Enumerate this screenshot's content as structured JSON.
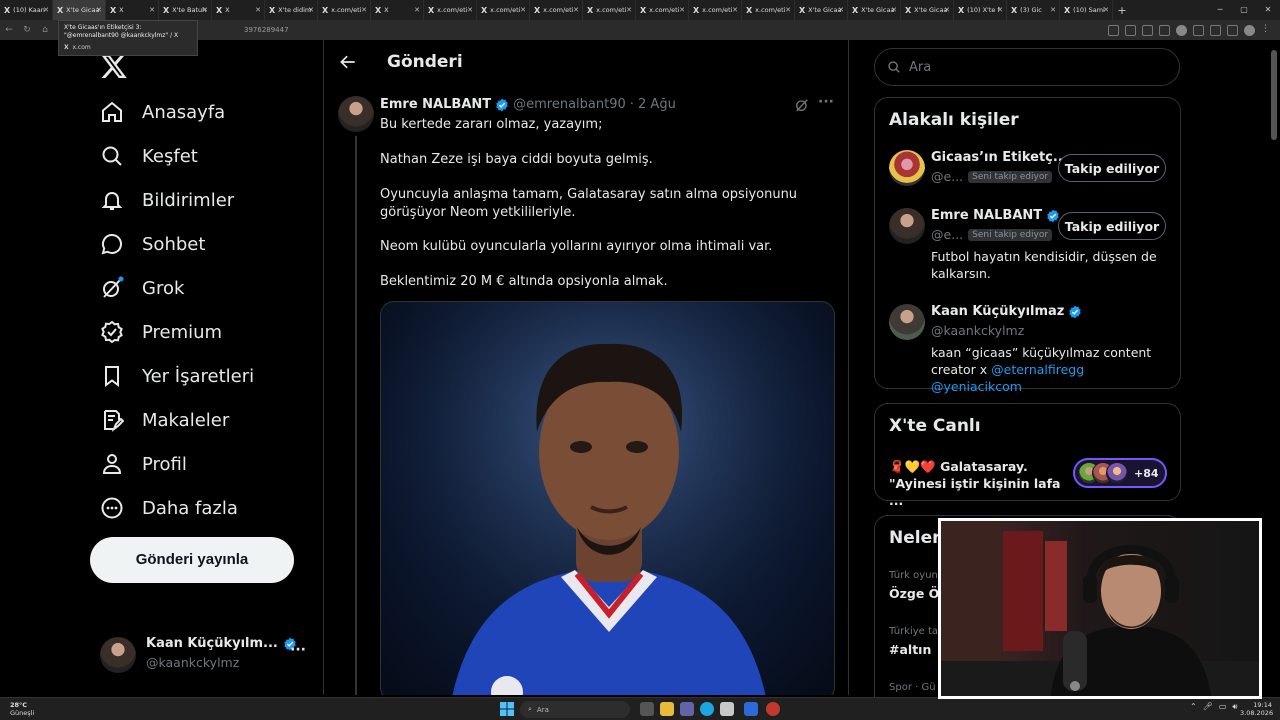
{
  "browser": {
    "tabs": [
      {
        "label": "(10) Kaan",
        "active": false
      },
      {
        "label": "X'te Gicaa",
        "active": true
      },
      {
        "label": "X",
        "active": false
      },
      {
        "label": "X'te Batuh",
        "active": false
      },
      {
        "label": "X",
        "active": false
      },
      {
        "label": "X'te didim",
        "active": false
      },
      {
        "label": "x.com/eti",
        "active": false
      },
      {
        "label": "X",
        "active": false
      },
      {
        "label": "x.com/eti",
        "active": false
      },
      {
        "label": "x.com/eti",
        "active": false
      },
      {
        "label": "x.com/eti",
        "active": false
      },
      {
        "label": "x.com/eti",
        "active": false
      },
      {
        "label": "x.com/eti",
        "active": false
      },
      {
        "label": "x.com/eti",
        "active": false
      },
      {
        "label": "x.com/eti",
        "active": false
      },
      {
        "label": "X'te Gicaa",
        "active": false
      },
      {
        "label": "X'te Gicaa",
        "active": false
      },
      {
        "label": "X'te Gicaa",
        "active": false
      },
      {
        "label": "(10) X'te f",
        "active": false
      },
      {
        "label": "(3) Gic",
        "active": false
      },
      {
        "label": "(10) Sami",
        "active": false
      }
    ],
    "url_tail": "3976289447",
    "tooltip_title": "X'te Gicaas'ın Etiketçisi 3: \"@emrenalbant90 @kaankckylmz\" / X",
    "tooltip_url": "x.com"
  },
  "sidebar": {
    "items": [
      {
        "label": "Anasayfa",
        "icon": "home-icon"
      },
      {
        "label": "Keşfet",
        "icon": "search-icon"
      },
      {
        "label": "Bildirimler",
        "icon": "bell-icon"
      },
      {
        "label": "Sohbet",
        "icon": "chat-icon"
      },
      {
        "label": "Grok",
        "icon": "grok-icon"
      },
      {
        "label": "Premium",
        "icon": "premium-icon"
      },
      {
        "label": "Yer İşaretleri",
        "icon": "bookmark-icon"
      },
      {
        "label": "Makaleler",
        "icon": "article-icon"
      },
      {
        "label": "Profil",
        "icon": "profile-icon"
      },
      {
        "label": "Daha fazla",
        "icon": "more-icon"
      }
    ],
    "post_button": "Gönderi yayınla",
    "account": {
      "name": "Kaan Küçükyılm...",
      "handle": "@kaankckylmz"
    }
  },
  "main": {
    "title": "Gönderi",
    "post": {
      "author": "Emre NALBANT",
      "handle": "@emrenalbant90",
      "date": "· 2 Ağu",
      "paragraphs": [
        "Bu kertede zararı olmaz, yazayım;",
        "Nathan Zeze işi baya ciddi boyuta gelmiş.",
        "Oyuncuyla anlaşma tamam, Galatasaray satın alma opsiyonunu görüşüyor Neom yetkilileriyle.",
        "Neom kulübü oyuncularla yollarını ayırıyor olma ihtimali var.",
        "Beklentimiz 20 M € altında opsiyonla almak."
      ]
    }
  },
  "right": {
    "search_placeholder": "Ara",
    "related": {
      "title": "Alakalı kişiler",
      "people": [
        {
          "name": "Gicaas’ın Etiketç...",
          "handle": "@e...",
          "badge": "Seni takip ediyor",
          "button": "Takip ediliyor",
          "bio": ""
        },
        {
          "name": "Emre NALBANT",
          "handle": "@e...",
          "badge": "Seni takip ediyor",
          "button": "Takip ediliyor",
          "bio": "Futbol hayatın kendisidir, düşsen de kalkarsın."
        },
        {
          "name": "Kaan Küçükyılmaz",
          "handle": "@kaankckylmz",
          "badge": "",
          "button": "",
          "bio_prefix": "kaan “gicaas” küçükyılmaz content creator x ",
          "bio_link1": "@eternalfiregg",
          "bio_link2": "@yeniacikcom"
        }
      ]
    },
    "live": {
      "title": "X'te Canlı",
      "emoji": "🧣💛❤️",
      "line1": "Galatasaray.",
      "line2": "\"Ayinesi iştir kişinin lafa ...",
      "count": "+84"
    },
    "trends": {
      "title": "Neler",
      "items": [
        {
          "context": "Türk oyun",
          "name": "Özge Öz"
        },
        {
          "context": "Türkiye ta",
          "name": "#altın"
        },
        {
          "context": "Spor · Gü",
          "name": ""
        }
      ]
    }
  },
  "taskbar": {
    "temp": "28°C",
    "weather": "Güneşli",
    "search": "Ara",
    "time": "19:14",
    "date": "3.08.2026"
  },
  "colors": {
    "accent": "#1d9bf0",
    "background": "#000000",
    "border": "#2f3336",
    "muted": "#71767b",
    "live": "#7856ff"
  }
}
